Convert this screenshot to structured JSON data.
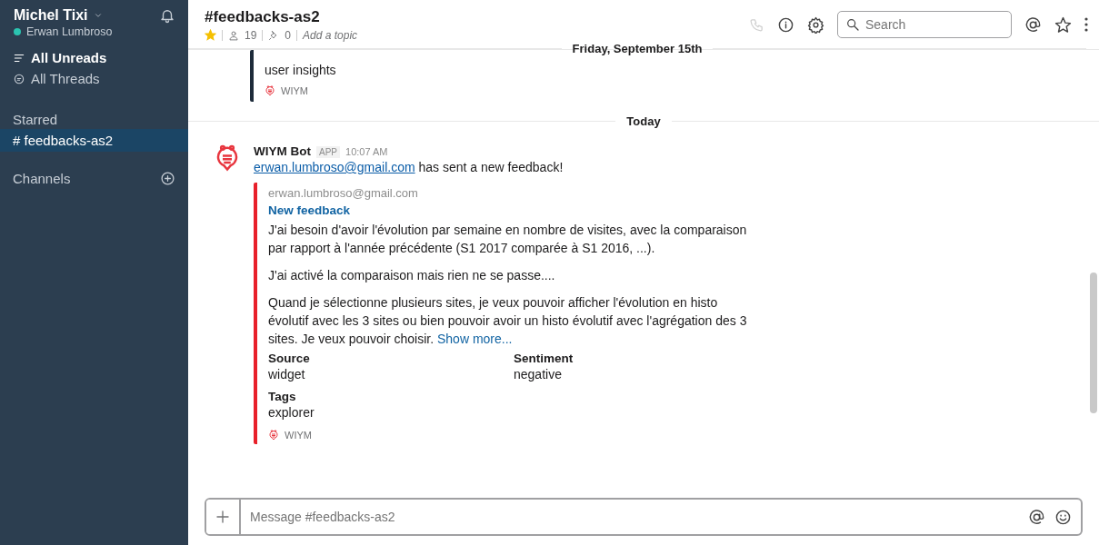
{
  "sidebar": {
    "team": "Michel Tixi",
    "user": "Erwan Lumbroso",
    "user_online": true,
    "nav": [
      {
        "label": "All Unreads",
        "kind": "unreads",
        "bold": true
      },
      {
        "label": "All Threads",
        "kind": "threads",
        "bold": false
      }
    ],
    "sections": [
      {
        "title": "Starred",
        "add_button": false,
        "items": [
          {
            "prefix": "#",
            "label": "feedbacks-as2",
            "selected": true
          }
        ]
      },
      {
        "title": "Channels",
        "add_button": true
      }
    ]
  },
  "header": {
    "channel": "#feedbacks-as2",
    "starred": true,
    "members": "19",
    "pins": "0",
    "topic_placeholder": "Add a topic",
    "search_placeholder": "Search"
  },
  "messages": [
    {
      "kind": "attachment_tail",
      "color": "#1d2b3a",
      "value": "user insights",
      "footer": "WIYM"
    },
    {
      "kind": "sticky_divider",
      "label": "Friday, September 15th"
    },
    {
      "kind": "divider",
      "label": "Today"
    },
    {
      "kind": "message",
      "author": "WIYM Bot",
      "badge": "APP",
      "time": "10:07 AM",
      "link": "erwan.lumbroso@gmail.com",
      "text": " has sent a new feedback!",
      "attachment": {
        "color": "#e8202a",
        "pretext": "erwan.lumbroso@gmail.com",
        "title": "New feedback",
        "paragraphs": [
          "J'ai besoin d'avoir l'évolution par semaine en nombre de visites, avec la comparaison par rapport à l'année précédente (S1 2017 comparée à S1 2016, ...).",
          "J'ai activé la comparaison mais rien ne se passe....",
          "Quand je sélectionne plusieurs sites, je veux pouvoir afficher l'évolution en histo évolutif avec les 3 sites ou bien pouvoir avoir un histo évolutif avec l'agrégation des 3 sites. Je veux pouvoir choisir."
        ],
        "show_more": "Show more...",
        "fields": [
          {
            "title": "Source",
            "value": "widget"
          },
          {
            "title": "Sentiment",
            "value": "negative"
          },
          {
            "title": "Tags",
            "value": "explorer"
          }
        ],
        "footer": "WIYM"
      }
    }
  ],
  "composer": {
    "placeholder": "Message #feedbacks-as2"
  }
}
